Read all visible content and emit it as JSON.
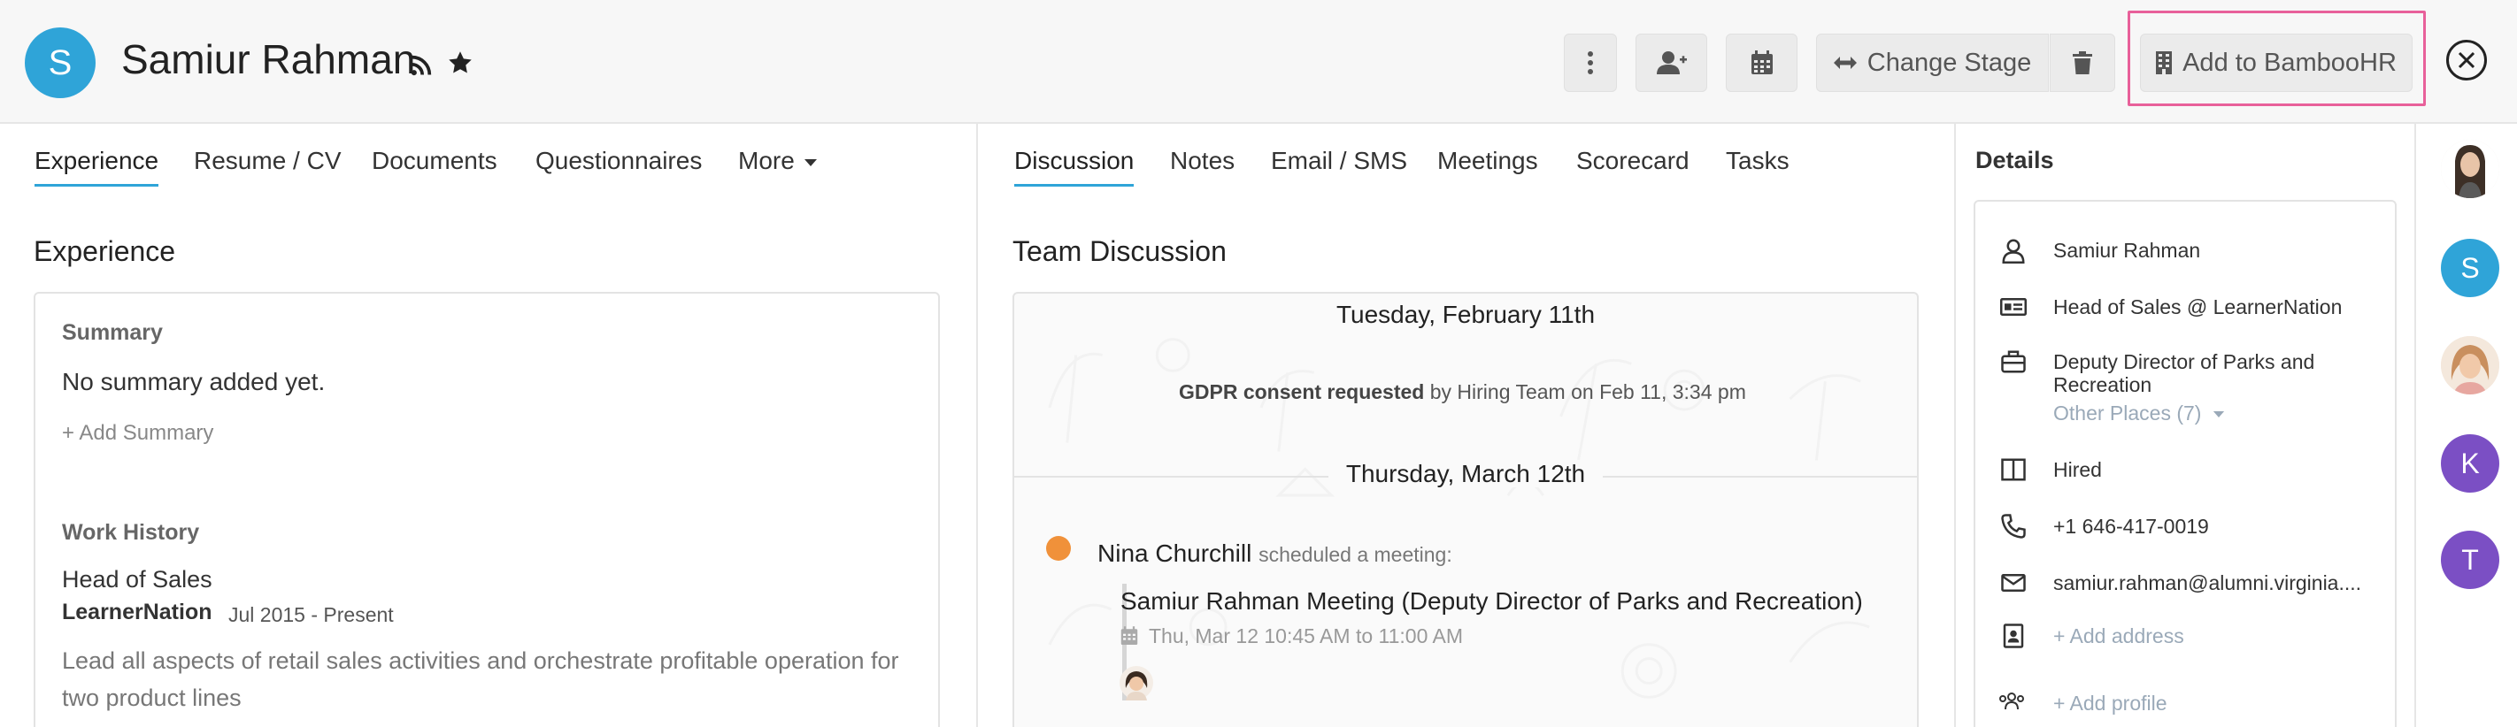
{
  "header": {
    "avatar_initial": "S",
    "candidate_name": "Samiur Rahman",
    "change_stage_label": "Change Stage",
    "add_bamboo_label": "Add to BambooHR"
  },
  "left_tabs": [
    "Experience",
    "Resume / CV",
    "Documents",
    "Questionnaires",
    "More"
  ],
  "middle_tabs": [
    "Discussion",
    "Notes",
    "Email / SMS",
    "Meetings",
    "Scorecard",
    "Tasks"
  ],
  "details_title": "Details",
  "experience": {
    "title": "Experience",
    "summary_label": "Summary",
    "summary_text": "No summary added yet.",
    "add_summary": "+ Add Summary",
    "work_history_label": "Work History",
    "job_title": "Head of Sales",
    "company": "LearnerNation",
    "dates": "Jul 2015 - Present",
    "description": "Lead all aspects of retail sales activities and orchestrate profitable operation for two product lines"
  },
  "discussion": {
    "title": "Team Discussion",
    "date1": "Tuesday, February 11th",
    "gdpr_bold": "GDPR consent requested",
    "gdpr_rest": "by Hiring Team on Feb 11, 3:34 pm",
    "date2": "Thursday, March 12th",
    "author": "Nina Churchill",
    "action": "scheduled a meeting:",
    "meeting_title": "Samiur Rahman Meeting (Deputy Director of Parks and Recreation)",
    "meeting_time": "Thu, Mar 12 10:45 AM to 11:00 AM",
    "status_color": "#f0913a"
  },
  "details": {
    "name": "Samiur Rahman",
    "headline": "Head of Sales @ LearnerNation",
    "position_line1": "Deputy Director of Parks and",
    "position_line2": "Recreation",
    "other_places": "Other Places (7)",
    "stage": "Hired",
    "phone": "+1 646-417-0019",
    "email": "samiur.rahman@alumni.virginia....",
    "add_address": "+ Add address",
    "add_profile": "+ Add profile"
  },
  "rail": {
    "s_initial": "S",
    "k_initial": "K",
    "t_initial": "T",
    "s_color": "#2fa4d8",
    "purple": "#7b4fc4"
  },
  "colors": {
    "accent": "#2fa4d8",
    "highlight": "#e8609a"
  }
}
